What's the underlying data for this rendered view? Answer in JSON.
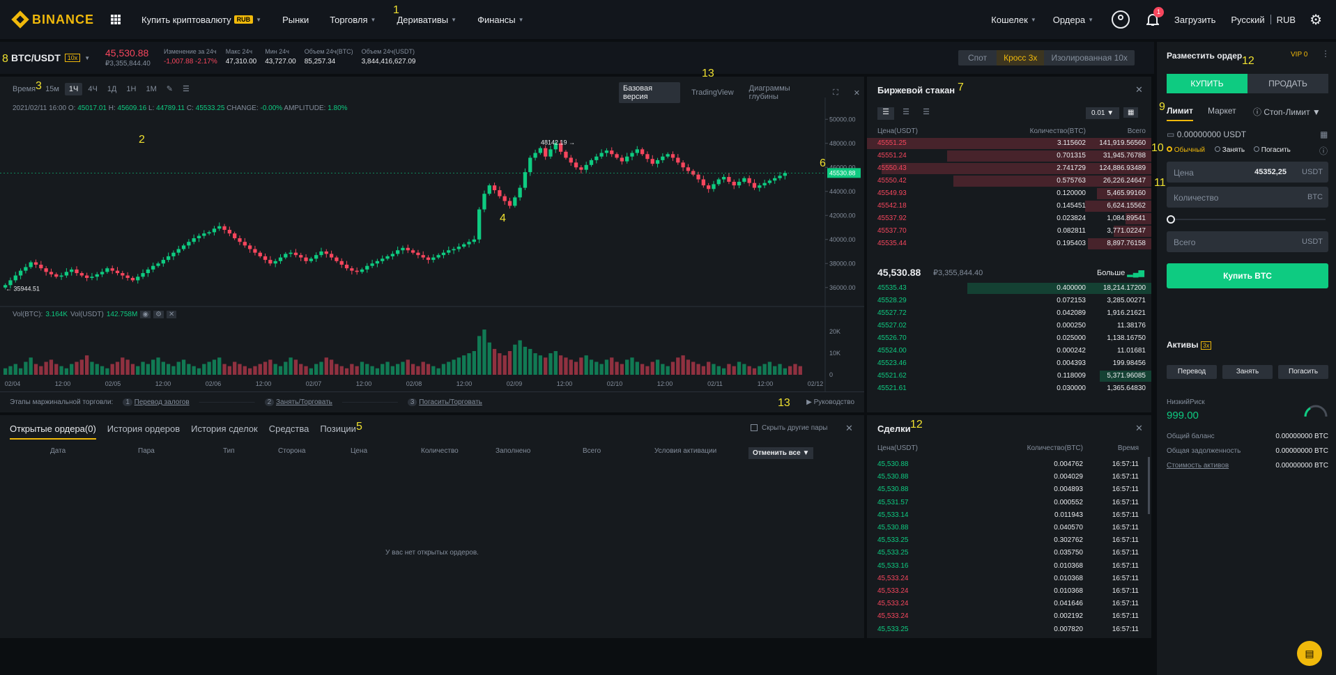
{
  "nav": {
    "logo": "BINANCE",
    "items": [
      {
        "label": "Купить криптовалюту",
        "badge": "RUB",
        "caret": true
      },
      {
        "label": "Рынки",
        "caret": false
      },
      {
        "label": "Торговля",
        "caret": true
      },
      {
        "label": "Деривативы",
        "caret": true
      },
      {
        "label": "Финансы",
        "caret": true
      }
    ],
    "right": {
      "wallet": "Кошелек",
      "orders": "Ордера",
      "notif_count": "1",
      "download": "Загрузить",
      "lang": "Русский",
      "currency": "RUB"
    }
  },
  "ticker": {
    "pair": "BTC/USDT",
    "leverage": "10x",
    "price": "45,530.88",
    "price_rub": "₽3,355,844.40",
    "stats": [
      {
        "k": "Изменение за 24ч",
        "v": "-1,007.88 -2.17%",
        "color": "#f6465d"
      },
      {
        "k": "Макс 24ч",
        "v": "47,310.00",
        "color": "#eaecef"
      },
      {
        "k": "Мин 24ч",
        "v": "43,727.00",
        "color": "#eaecef"
      },
      {
        "k": "Объем 24ч(BTC)",
        "v": "85,257.34",
        "color": "#eaecef"
      },
      {
        "k": "Объем 24ч(USDT)",
        "v": "3,844,416,627.09",
        "color": "#eaecef"
      }
    ],
    "modes": [
      "Спот",
      "Кросс 3x",
      "Изолированная 10x"
    ]
  },
  "chart_toolbar": {
    "time_label": "Время",
    "intervals": [
      "15м",
      "1Ч",
      "4Ч",
      "1Д",
      "1Н",
      "1М"
    ],
    "active": "1Ч",
    "views": [
      "Базовая версия",
      "TradingView",
      "Диаграммы глубины"
    ]
  },
  "chart_info": {
    "date": "2021/02/11 16:00",
    "o": "45017.01",
    "h": "45609.16",
    "l": "44789.11",
    "c": "45533.25",
    "change": "-0.00%",
    "amplitude": "1.80%"
  },
  "chart_data": {
    "type": "candlestick",
    "y_ticks": [
      "50000.00",
      "48000.00",
      "46000.00",
      "44000.00",
      "42000.00",
      "40000.00",
      "38000.00",
      "36000.00"
    ],
    "ylim": [
      35000,
      51000
    ],
    "x_ticks": [
      "02/04",
      "12:00",
      "02/05",
      "12:00",
      "02/06",
      "12:00",
      "02/07",
      "12:00",
      "02/08",
      "12:00",
      "02/09",
      "12:00",
      "02/10",
      "12:00",
      "02/11",
      "12:00",
      "02/12"
    ],
    "high_label": "48142.19",
    "low_label": "35944.51",
    "last_price": "45530.88",
    "closes": [
      36200,
      36600,
      37000,
      37400,
      37700,
      38100,
      37900,
      37600,
      37300,
      37100,
      36900,
      37000,
      37300,
      37500,
      37200,
      37000,
      36800,
      36900,
      37100,
      37300,
      37600,
      37400,
      37200,
      37000,
      36800,
      36600,
      36900,
      37200,
      37500,
      37800,
      38000,
      38300,
      38600,
      38900,
      39200,
      39500,
      39800,
      40100,
      40300,
      40500,
      40600,
      40900,
      41100,
      40800,
      40500,
      40100,
      39800,
      39500,
      39200,
      38900,
      38600,
      38300,
      38000,
      38200,
      38500,
      38800,
      38900,
      38700,
      38500,
      38200,
      38400,
      38700,
      39000,
      38800,
      38500,
      38200,
      37900,
      37600,
      37400,
      37300,
      37500,
      37800,
      38000,
      38200,
      38400,
      38600,
      38800,
      39100,
      39300,
      39100,
      38900,
      38700,
      38500,
      38300,
      38500,
      38700,
      38900,
      39100,
      39200,
      39400,
      39600,
      39800,
      40000,
      42500,
      43800,
      44500,
      44100,
      43600,
      43200,
      42800,
      43500,
      44300,
      45600,
      46800,
      47200,
      47600,
      46900,
      47500,
      48000,
      47300,
      46800,
      46400,
      46000,
      45800,
      46200,
      46600,
      46900,
      47200,
      47400,
      47100,
      46800,
      46500,
      46900,
      47200,
      47500,
      47100,
      46700,
      46300,
      46600,
      46900,
      47100,
      46800,
      46400,
      46000,
      45700,
      45400,
      45000,
      44500,
      44200,
      44600,
      45000,
      45200,
      44800,
      44500,
      44800,
      45100,
      44700,
      44300,
      44500,
      44700,
      44900,
      45100,
      45300,
      45530
    ],
    "vol_ticks": [
      "20K",
      "10K",
      "0"
    ],
    "volumes": [
      3,
      4,
      5,
      3,
      6,
      8,
      5,
      4,
      6,
      7,
      5,
      4,
      3,
      5,
      6,
      7,
      9,
      6,
      5,
      4,
      3,
      5,
      6,
      8,
      7,
      5,
      4,
      6,
      5,
      7,
      8,
      6,
      5,
      4,
      6,
      7,
      5,
      4,
      3,
      5,
      6,
      7,
      8,
      5,
      4,
      6,
      5,
      4,
      3,
      4,
      5,
      6,
      7,
      5,
      4,
      6,
      8,
      7,
      5,
      4,
      3,
      5,
      6,
      8,
      7,
      5,
      4,
      3,
      5,
      4,
      6,
      5,
      4,
      3,
      5,
      6,
      4,
      5,
      6,
      7,
      5,
      4,
      6,
      5,
      4,
      3,
      5,
      6,
      7,
      8,
      9,
      10,
      11,
      18,
      21,
      15,
      12,
      10,
      9,
      11,
      14,
      16,
      13,
      12,
      10,
      9,
      8,
      10,
      11,
      9,
      8,
      7,
      6,
      8,
      9,
      7,
      6,
      5,
      7,
      8,
      6,
      5,
      7,
      8,
      6,
      5,
      4,
      6,
      7,
      5,
      4,
      6,
      8,
      9,
      7,
      6,
      5,
      4,
      6,
      5,
      4,
      3,
      5,
      4,
      6,
      5,
      4,
      3,
      4,
      5,
      6,
      4,
      5,
      3,
      4,
      5,
      4
    ]
  },
  "vol_info": {
    "label1": "Vol(BTC):",
    "v1": "3.164K",
    "label2": "Vol(USDT)",
    "v2": "142.758M"
  },
  "margin_steps": {
    "label": "Этапы маржинальной торговли:",
    "steps": [
      {
        "n": "1",
        "t": "Перевод залогов"
      },
      {
        "n": "2",
        "t": "Занять/Торговать"
      },
      {
        "n": "3",
        "t": "Погасить/Торговать"
      }
    ],
    "guide": "Руководство"
  },
  "orders": {
    "tabs": [
      "Открытые ордера(0)",
      "История ордеров",
      "История сделок",
      "Средства",
      "Позиции"
    ],
    "hide_pairs": "Скрыть другие пары",
    "columns": [
      "Дата",
      "Пара",
      "Тип",
      "Сторона",
      "Цена",
      "Количество",
      "Заполнено",
      "Всего",
      "Условия активации"
    ],
    "cancel_all": "Отменить все",
    "empty": "У вас нет открытых ордеров."
  },
  "orderbook": {
    "title": "Биржевой стакан",
    "precision": "0.01",
    "headers": [
      "Цена(USDT)",
      "Количество(BTC)",
      "Всего"
    ],
    "asks": [
      [
        "45551.25",
        "3.115602",
        "141,919.56560",
        1.0
      ],
      [
        "45551.24",
        "0.701315",
        "31,945.76788",
        0.72
      ],
      [
        "45550.43",
        "2.741729",
        "124,886.93489",
        0.95
      ],
      [
        "45550.42",
        "0.575763",
        "26,226.24647",
        0.7
      ],
      [
        "45549.93",
        "0.120000",
        "5,465.99160",
        0.2
      ],
      [
        "45542.18",
        "0.145451",
        "6,624.15562",
        0.24
      ],
      [
        "45537.92",
        "0.023824",
        "1,084.89541",
        0.1
      ],
      [
        "45537.70",
        "0.082811",
        "3,771.02247",
        0.14
      ],
      [
        "45535.44",
        "0.195403",
        "8,897.76158",
        0.23
      ]
    ],
    "mid_price": "45,530.88",
    "mid_rub": "₽3,355,844.40",
    "more": "Больше",
    "bids": [
      [
        "45535.43",
        "0.400000",
        "18,214.17200",
        0.65
      ],
      [
        "45528.29",
        "0.072153",
        "3,285.00271",
        0.0
      ],
      [
        "45527.72",
        "0.042089",
        "1,916.21621",
        0.0
      ],
      [
        "45527.02",
        "0.000250",
        "11.38176",
        0.0
      ],
      [
        "45526.70",
        "0.025000",
        "1,138.16750",
        0.0
      ],
      [
        "45524.00",
        "0.000242",
        "11.01681",
        0.0
      ],
      [
        "45523.46",
        "0.004393",
        "199.98456",
        0.0
      ],
      [
        "45521.62",
        "0.118009",
        "5,371.96085",
        0.19
      ],
      [
        "45521.61",
        "0.030000",
        "1,365.64830",
        0.0
      ]
    ]
  },
  "trades": {
    "title": "Сделки",
    "headers": [
      "Цена(USDT)",
      "Количество(BTC)",
      "Время"
    ],
    "rows": [
      [
        "45,530.88",
        "0.004762",
        "16:57:11",
        "g"
      ],
      [
        "45,530.88",
        "0.004029",
        "16:57:11",
        "g"
      ],
      [
        "45,530.88",
        "0.004893",
        "16:57:11",
        "g"
      ],
      [
        "45,531.57",
        "0.000552",
        "16:57:11",
        "g"
      ],
      [
        "45,533.14",
        "0.011943",
        "16:57:11",
        "g"
      ],
      [
        "45,530.88",
        "0.040570",
        "16:57:11",
        "g"
      ],
      [
        "45,533.25",
        "0.302762",
        "16:57:11",
        "g"
      ],
      [
        "45,533.25",
        "0.035750",
        "16:57:11",
        "g"
      ],
      [
        "45,533.16",
        "0.010368",
        "16:57:11",
        "g"
      ],
      [
        "45,533.24",
        "0.010368",
        "16:57:11",
        "r"
      ],
      [
        "45,533.24",
        "0.010368",
        "16:57:11",
        "r"
      ],
      [
        "45,533.24",
        "0.041646",
        "16:57:11",
        "r"
      ],
      [
        "45,533.24",
        "0.002192",
        "16:57:11",
        "r"
      ],
      [
        "45,533.25",
        "0.007820",
        "16:57:11",
        "g"
      ]
    ]
  },
  "order_form": {
    "title": "Разместить ордер",
    "vip": "VIP 0",
    "buy": "КУПИТЬ",
    "sell": "ПРОДАТЬ",
    "types": [
      "Лимит",
      "Маркет",
      "Стоп-Лимит"
    ],
    "balance": "0.00000000 USDT",
    "modes": [
      "Обычный",
      "Занять",
      "Погасить"
    ],
    "price_label": "Цена",
    "price_value": "45352,25",
    "price_unit": "USDT",
    "qty_label": "Количество",
    "qty_unit": "BTC",
    "total_label": "Всего",
    "total_unit": "USDT",
    "submit": "Купить BTC"
  },
  "assets": {
    "title": "Активы",
    "lev": "3x",
    "buttons": [
      "Перевод",
      "Занять",
      "Погасить"
    ],
    "risk_label": "НизкийРиск",
    "risk_value": "999.00",
    "rows": [
      [
        "Общий баланс",
        "0.00000000 BTC"
      ],
      [
        "Общая задолженность",
        "0.00000000 BTC"
      ],
      [
        "Стоимость активов",
        "0.00000000 BTC"
      ]
    ]
  },
  "annotations": [
    "1",
    "2",
    "3",
    "4",
    "5",
    "6",
    "7",
    "8",
    "9",
    "10",
    "11",
    "12",
    "12",
    "13",
    "13"
  ]
}
